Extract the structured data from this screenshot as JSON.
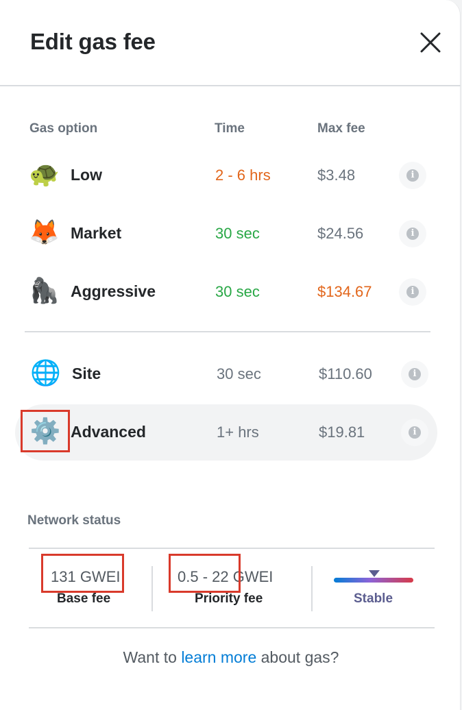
{
  "header": {
    "title": "Edit gas fee",
    "close_icon": "close-icon"
  },
  "columns": {
    "option": "Gas option",
    "time": "Time",
    "max_fee": "Max fee"
  },
  "colors": {
    "orange": "#e2661b",
    "green": "#28a745",
    "text": "#24272a",
    "muted": "#6a737d",
    "link": "#037dd6",
    "annotation_red": "#d93a2b"
  },
  "options": [
    {
      "icon": "turtle-icon",
      "emoji": "🐢",
      "label": "Low",
      "time": "2 - 6 hrs",
      "time_color": "orange",
      "fee": "$3.48",
      "fee_color": "muted"
    },
    {
      "icon": "fox-icon",
      "emoji": "🦊",
      "label": "Market",
      "time": "30 sec",
      "time_color": "green",
      "fee": "$24.56",
      "fee_color": "muted"
    },
    {
      "icon": "gorilla-icon",
      "emoji": "🦍",
      "label": "Aggressive",
      "time": "30 sec",
      "time_color": "green",
      "fee": "$134.67",
      "fee_color": "orange"
    },
    {
      "icon": "globe-icon",
      "emoji": "🌐",
      "label": "Site",
      "time": "30 sec",
      "time_color": "muted",
      "fee": "$110.60",
      "fee_color": "muted"
    },
    {
      "icon": "gear-icon",
      "emoji": "⚙️",
      "label": "Advanced",
      "time": "1+ hrs",
      "time_color": "muted",
      "fee": "$19.81",
      "fee_color": "muted",
      "selected": true
    }
  ],
  "network": {
    "title": "Network status",
    "base_fee_value": "131 GWEI",
    "base_fee_label": "Base fee",
    "priority_fee_value": "0.5 - 22 GWEI",
    "priority_fee_label": "Priority fee",
    "status_label": "Stable"
  },
  "footer": {
    "prefix": "Want to ",
    "link": "learn more",
    "suffix": " about gas?"
  }
}
